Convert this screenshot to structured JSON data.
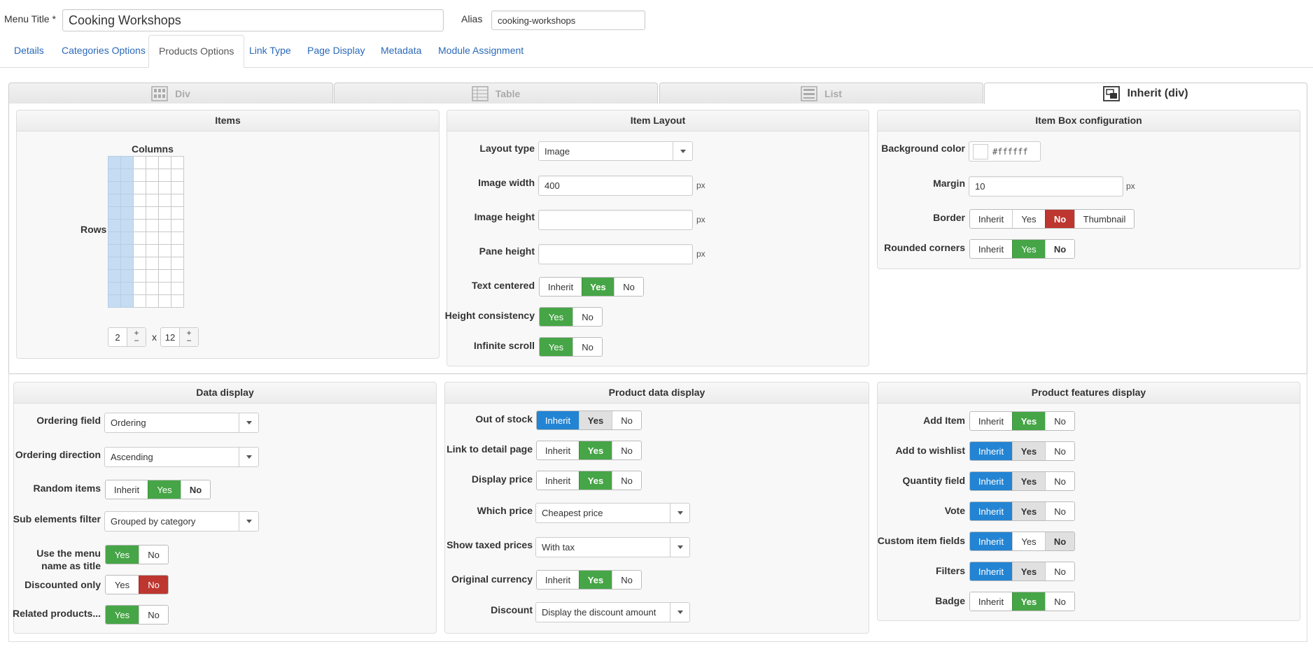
{
  "header": {
    "menu_title_label": "Menu Title *",
    "menu_title_value": "Cooking Workshops",
    "alias_label": "Alias",
    "alias_value": "cooking-workshops"
  },
  "tabs": [
    {
      "label": "Details"
    },
    {
      "label": "Categories Options"
    },
    {
      "label": "Products Options",
      "active": true
    },
    {
      "label": "Link Type"
    },
    {
      "label": "Page Display"
    },
    {
      "label": "Metadata"
    },
    {
      "label": "Module Assignment"
    }
  ],
  "layout_tabs": [
    {
      "label": "Div"
    },
    {
      "label": "Table"
    },
    {
      "label": "List"
    },
    {
      "label": "Inherit (div)",
      "active": true
    }
  ],
  "items_panel": {
    "title": "Items",
    "columns_label": "Columns",
    "rows_label": "Rows",
    "selected_columns": 2,
    "total_grid_columns": 6,
    "selected_rows": 12,
    "columns_value": "2",
    "times": "x",
    "rows_value": "12",
    "plus": "+",
    "minus": "−"
  },
  "item_layout": {
    "title": "Item Layout",
    "layout_type_label": "Layout type",
    "layout_type_value": "Image",
    "image_width_label": "Image width",
    "image_width_value": "400",
    "image_height_label": "Image height",
    "image_height_value": "",
    "pane_height_label": "Pane height",
    "pane_height_value": "",
    "unit": "px",
    "text_centered_label": "Text centered",
    "height_consistency_label": "Height consistency",
    "infinite_scroll_label": "Infinite scroll"
  },
  "item_box": {
    "title": "Item Box configuration",
    "bg_color_label": "Background color",
    "bg_color_value": "#ffffff",
    "margin_label": "Margin",
    "margin_value": "10",
    "unit": "px",
    "border_label": "Border",
    "rounded_label": "Rounded corners"
  },
  "data_display": {
    "title": "Data display",
    "ordering_field_label": "Ordering field",
    "ordering_field_value": "Ordering",
    "ordering_direction_label": "Ordering direction",
    "ordering_direction_value": "Ascending",
    "random_items_label": "Random items",
    "sub_elements_label": "Sub elements filter",
    "sub_elements_value": "Grouped by category",
    "use_menu_name_label_1": "Use the menu",
    "use_menu_name_label_2": "name as title",
    "discounted_only_label": "Discounted only",
    "related_products_label": "Related products..."
  },
  "product_data": {
    "title": "Product data display",
    "out_of_stock_label": "Out of stock",
    "link_detail_label": "Link to detail page",
    "display_price_label": "Display price",
    "which_price_label": "Which price",
    "which_price_value": "Cheapest price",
    "show_taxed_label": "Show taxed prices",
    "show_taxed_value": "With tax",
    "original_currency_label": "Original currency",
    "discount_label": "Discount",
    "discount_value": "Display the discount amount"
  },
  "product_features": {
    "title": "Product features display",
    "add_item_label": "Add Item",
    "add_wishlist_label": "Add to wishlist",
    "quantity_field_label": "Quantity field",
    "vote_label": "Vote",
    "custom_fields_label": "Custom item fields",
    "filters_label": "Filters",
    "badge_label": "Badge"
  },
  "options": {
    "inherit": "Inherit",
    "yes": "Yes",
    "no": "No",
    "thumbnail": "Thumbnail"
  },
  "colors": {
    "green": "#46a546",
    "red": "#bd362f",
    "blue": "#2384d3",
    "link": "#2a69b8"
  }
}
